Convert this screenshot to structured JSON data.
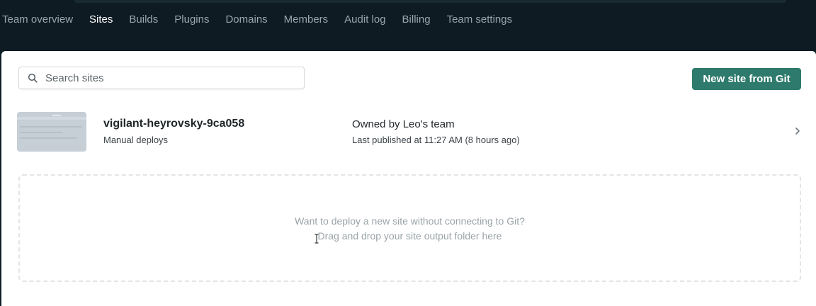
{
  "nav": {
    "tabs": [
      {
        "label": "Team overview",
        "active": false
      },
      {
        "label": "Sites",
        "active": true
      },
      {
        "label": "Builds",
        "active": false
      },
      {
        "label": "Plugins",
        "active": false
      },
      {
        "label": "Domains",
        "active": false
      },
      {
        "label": "Members",
        "active": false
      },
      {
        "label": "Audit log",
        "active": false
      },
      {
        "label": "Billing",
        "active": false
      },
      {
        "label": "Team settings",
        "active": false
      }
    ]
  },
  "toolbar": {
    "search_placeholder": "Search sites",
    "search_value": "",
    "new_site_label": "New site from Git"
  },
  "sites": [
    {
      "name": "vigilant-heyrovsky-9ca058",
      "deploy_type": "Manual deploys",
      "owner": "Owned by Leo's team",
      "last_published": "Last published at 11:27 AM (8 hours ago)"
    }
  ],
  "dropzone": {
    "line1": "Want to deploy a new site without connecting to Git?",
    "line2": "Drag and drop your site output folder here"
  },
  "colors": {
    "nav_bg": "#0e1b23",
    "accent": "#2e7a6c",
    "tab_inactive": "#9aa6ad",
    "tab_active": "#ffffff"
  }
}
